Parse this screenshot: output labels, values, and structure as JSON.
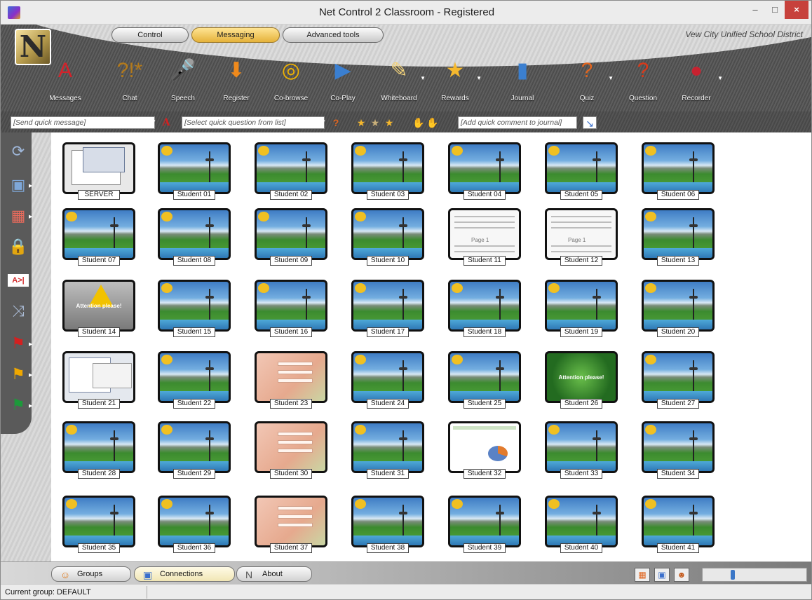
{
  "window": {
    "title": "Net Control 2 Classroom - Registered",
    "controls": [
      "–",
      "□",
      "×"
    ]
  },
  "ribbon": {
    "logo": "N",
    "tabs": [
      {
        "label": "Control",
        "active": false
      },
      {
        "label": "Messaging",
        "active": true
      },
      {
        "label": "Advanced tools",
        "active": false
      }
    ],
    "district": "Vew City Unified School District",
    "tools": [
      {
        "label": "Messages",
        "icon": "messages-icon",
        "glyph": "A",
        "color": "#d4222a",
        "dropdown": false
      },
      {
        "label": "Chat",
        "icon": "chat-icon",
        "glyph": "?!*",
        "color": "#b37a1c",
        "dropdown": false
      },
      {
        "label": "Speech",
        "icon": "microphone-icon",
        "glyph": "🎤",
        "color": "#dddddd",
        "dropdown": false
      },
      {
        "label": "Register",
        "icon": "register-icon",
        "glyph": "⬇",
        "color": "#f08a1c",
        "dropdown": false
      },
      {
        "label": "Co-browse",
        "icon": "co-browse-icon",
        "glyph": "◎",
        "color": "#f2b400",
        "dropdown": false
      },
      {
        "label": "Co-Play",
        "icon": "co-play-icon",
        "glyph": "▶",
        "color": "#3a7fd1",
        "dropdown": false
      },
      {
        "label": "Whiteboard",
        "icon": "whiteboard-icon",
        "glyph": "✎",
        "color": "#f2d27a",
        "dropdown": true
      },
      {
        "label": "Rewards",
        "icon": "star-icon",
        "glyph": "★",
        "color": "#f5b82e",
        "dropdown": true
      },
      {
        "label": "Journal",
        "icon": "journal-icon",
        "glyph": "▮",
        "color": "#3b7fcf",
        "dropdown": false
      },
      {
        "label": "Quiz",
        "icon": "quiz-icon",
        "glyph": "?",
        "color": "#e0651f",
        "dropdown": true
      },
      {
        "label": "Question",
        "icon": "question-icon",
        "glyph": "?",
        "color": "#d83a1a",
        "dropdown": false
      },
      {
        "label": "Recorder",
        "icon": "recorder-icon",
        "glyph": "●",
        "color": "#c82230",
        "dropdown": true
      }
    ]
  },
  "quickbar": {
    "message_placeholder": "[Send quick message]",
    "question_placeholder": "[Select quick question from list]",
    "journal_placeholder": "[Add quick comment to journal]"
  },
  "sidebar": {
    "icons": [
      {
        "name": "refresh-icon",
        "glyph": "⟳",
        "color": "#9fb7d9",
        "arrow": false
      },
      {
        "name": "monitor-icon",
        "glyph": "▣",
        "color": "#7ea7d8",
        "arrow": true
      },
      {
        "name": "layout-icon",
        "glyph": "▦",
        "color": "#e86b5c",
        "arrow": true
      },
      {
        "name": "lock-user-icon",
        "glyph": "🔒",
        "color": "#f0b33a",
        "arrow": false
      },
      {
        "name": "text-cursor-icon",
        "glyph": "A>|",
        "color": "#d22b2b",
        "arrow": false
      },
      {
        "name": "shuffle-icon",
        "glyph": "⤨",
        "color": "#a9bad4",
        "arrow": false
      },
      {
        "name": "red-flag-icon",
        "glyph": "⚑",
        "color": "#d42020",
        "arrow": true
      },
      {
        "name": "yellow-flag-icon",
        "glyph": "⚑",
        "color": "#f0a800",
        "arrow": true
      },
      {
        "name": "green-flag-icon",
        "glyph": "⚑",
        "color": "#1c9a3a",
        "arrow": true
      }
    ]
  },
  "students": [
    {
      "name": "SERVER",
      "screen": "server"
    },
    {
      "name": "Student 01",
      "screen": "desktop"
    },
    {
      "name": "Student 02",
      "screen": "desktop"
    },
    {
      "name": "Student 03",
      "screen": "desktop"
    },
    {
      "name": "Student 04",
      "screen": "desktop"
    },
    {
      "name": "Student 05",
      "screen": "desktop"
    },
    {
      "name": "Student 06",
      "screen": "desktop"
    },
    {
      "name": "Student 07",
      "screen": "desktop"
    },
    {
      "name": "Student 08",
      "screen": "desktop"
    },
    {
      "name": "Student 09",
      "screen": "desktop"
    },
    {
      "name": "Student 10",
      "screen": "desktop"
    },
    {
      "name": "Student 11",
      "screen": "doc",
      "text": "Page 1"
    },
    {
      "name": "Student 12",
      "screen": "doc",
      "text": "Page 1"
    },
    {
      "name": "Student 13",
      "screen": "desktop"
    },
    {
      "name": "Student 14",
      "screen": "alert",
      "text": "Attention please!"
    },
    {
      "name": "Student 15",
      "screen": "desktop"
    },
    {
      "name": "Student 16",
      "screen": "desktop"
    },
    {
      "name": "Student 17",
      "screen": "desktop"
    },
    {
      "name": "Student 18",
      "screen": "desktop"
    },
    {
      "name": "Student 19",
      "screen": "desktop"
    },
    {
      "name": "Student 20",
      "screen": "desktop"
    },
    {
      "name": "Student 21",
      "screen": "shot21"
    },
    {
      "name": "Student 22",
      "screen": "desktop"
    },
    {
      "name": "Student 23",
      "screen": "peach"
    },
    {
      "name": "Student 24",
      "screen": "desktop"
    },
    {
      "name": "Student 25",
      "screen": "desktop"
    },
    {
      "name": "Student 26",
      "screen": "green",
      "text": "Attention please!"
    },
    {
      "name": "Student 27",
      "screen": "desktop"
    },
    {
      "name": "Student 28",
      "screen": "desktop"
    },
    {
      "name": "Student 29",
      "screen": "desktop"
    },
    {
      "name": "Student 30",
      "screen": "peach"
    },
    {
      "name": "Student 31",
      "screen": "desktop"
    },
    {
      "name": "Student 32",
      "screen": "excel"
    },
    {
      "name": "Student 33",
      "screen": "desktop"
    },
    {
      "name": "Student 34",
      "screen": "desktop"
    },
    {
      "name": "Student 35",
      "screen": "desktop"
    },
    {
      "name": "Student 36",
      "screen": "desktop"
    },
    {
      "name": "Student 37",
      "screen": "peach"
    },
    {
      "name": "Student 38",
      "screen": "desktop"
    },
    {
      "name": "Student 39",
      "screen": "desktop"
    },
    {
      "name": "Student 40",
      "screen": "desktop"
    },
    {
      "name": "Student 41",
      "screen": "desktop"
    }
  ],
  "bottom_tabs": [
    {
      "label": "Groups",
      "icon": "groups-icon",
      "active": false
    },
    {
      "label": "Connections",
      "icon": "connections-icon",
      "active": true
    },
    {
      "label": "About",
      "icon": "about-icon",
      "active": false
    }
  ],
  "view_buttons": [
    {
      "name": "grid-view-icon",
      "glyph": "▦"
    },
    {
      "name": "monitor-view-icon",
      "glyph": "▣"
    },
    {
      "name": "user-view-icon",
      "glyph": "☻"
    }
  ],
  "status": {
    "current_group": "Current group: DEFAULT"
  }
}
